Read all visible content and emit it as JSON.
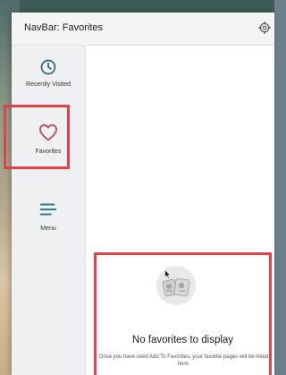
{
  "header": {
    "title": "NavBar: Favorites",
    "settings_icon": "gear-icon"
  },
  "sidebar": {
    "items": [
      {
        "label": "Recently Visited",
        "icon": "clock-icon",
        "selected": false
      },
      {
        "label": "Favorites",
        "icon": "heart-icon",
        "selected": true
      },
      {
        "label": "Menu",
        "icon": "hamburger-menu-icon",
        "selected": false
      }
    ]
  },
  "main": {
    "empty_state": {
      "icon": "favorites-illustration-icon",
      "title": "No favorites to display",
      "description": "Once you have used Add To Favorites, your favorite pages will be listed here."
    }
  },
  "colors": {
    "accent": "#2a7f8a",
    "highlight": "#e0434b",
    "heart": "#c0465a"
  }
}
